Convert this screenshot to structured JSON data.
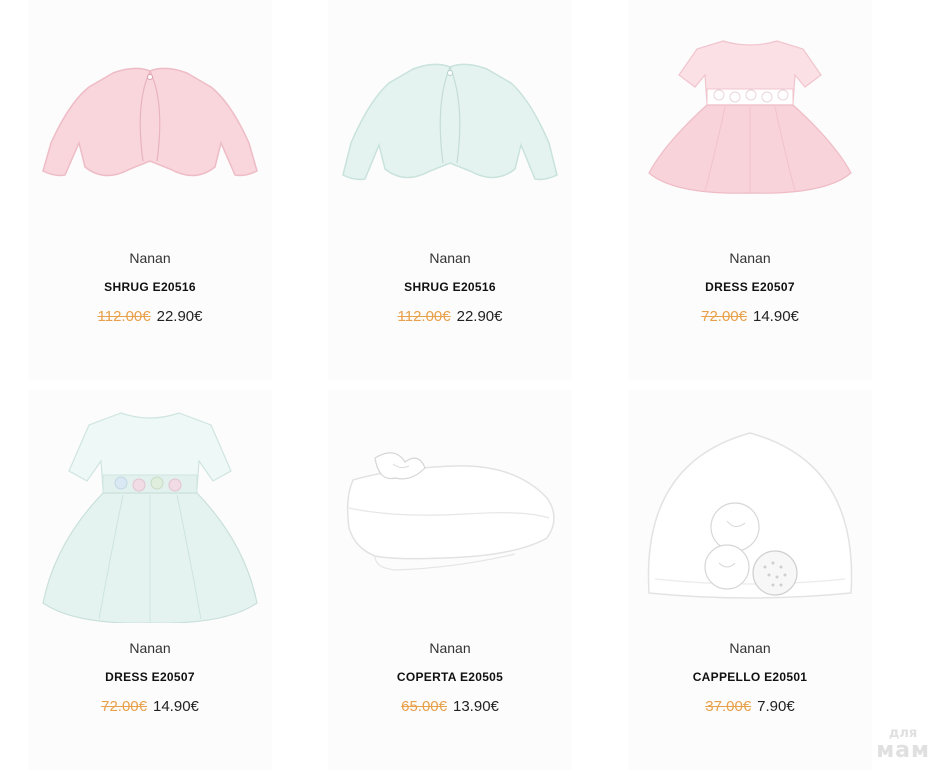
{
  "products": [
    {
      "brand": "Nanan",
      "title": "SHRUG E20516",
      "old_price": "112.00€",
      "new_price": "22.90€",
      "image": "pink-shrug"
    },
    {
      "brand": "Nanan",
      "title": "SHRUG E20516",
      "old_price": "112.00€",
      "new_price": "22.90€",
      "image": "mint-shrug"
    },
    {
      "brand": "Nanan",
      "title": "DRESS E20507",
      "old_price": "72.00€",
      "new_price": "14.90€",
      "image": "pink-tulle-dress"
    },
    {
      "brand": "Nanan",
      "title": "DRESS E20507",
      "old_price": "72.00€",
      "new_price": "14.90€",
      "image": "mint-tulle-dress"
    },
    {
      "brand": "Nanan",
      "title": "COPERTA E20505",
      "old_price": "65.00€",
      "new_price": "13.90€",
      "image": "white-blanket"
    },
    {
      "brand": "Nanan",
      "title": "CAPPELLO E20501",
      "old_price": "37.00€",
      "new_price": "7.90€",
      "image": "white-hat"
    }
  ],
  "watermark": {
    "top": "для",
    "bottom": "мам"
  },
  "colors": {
    "old_price": "#e8a04a",
    "pink": "#f8d6dc",
    "mint": "#e4f3f0"
  }
}
